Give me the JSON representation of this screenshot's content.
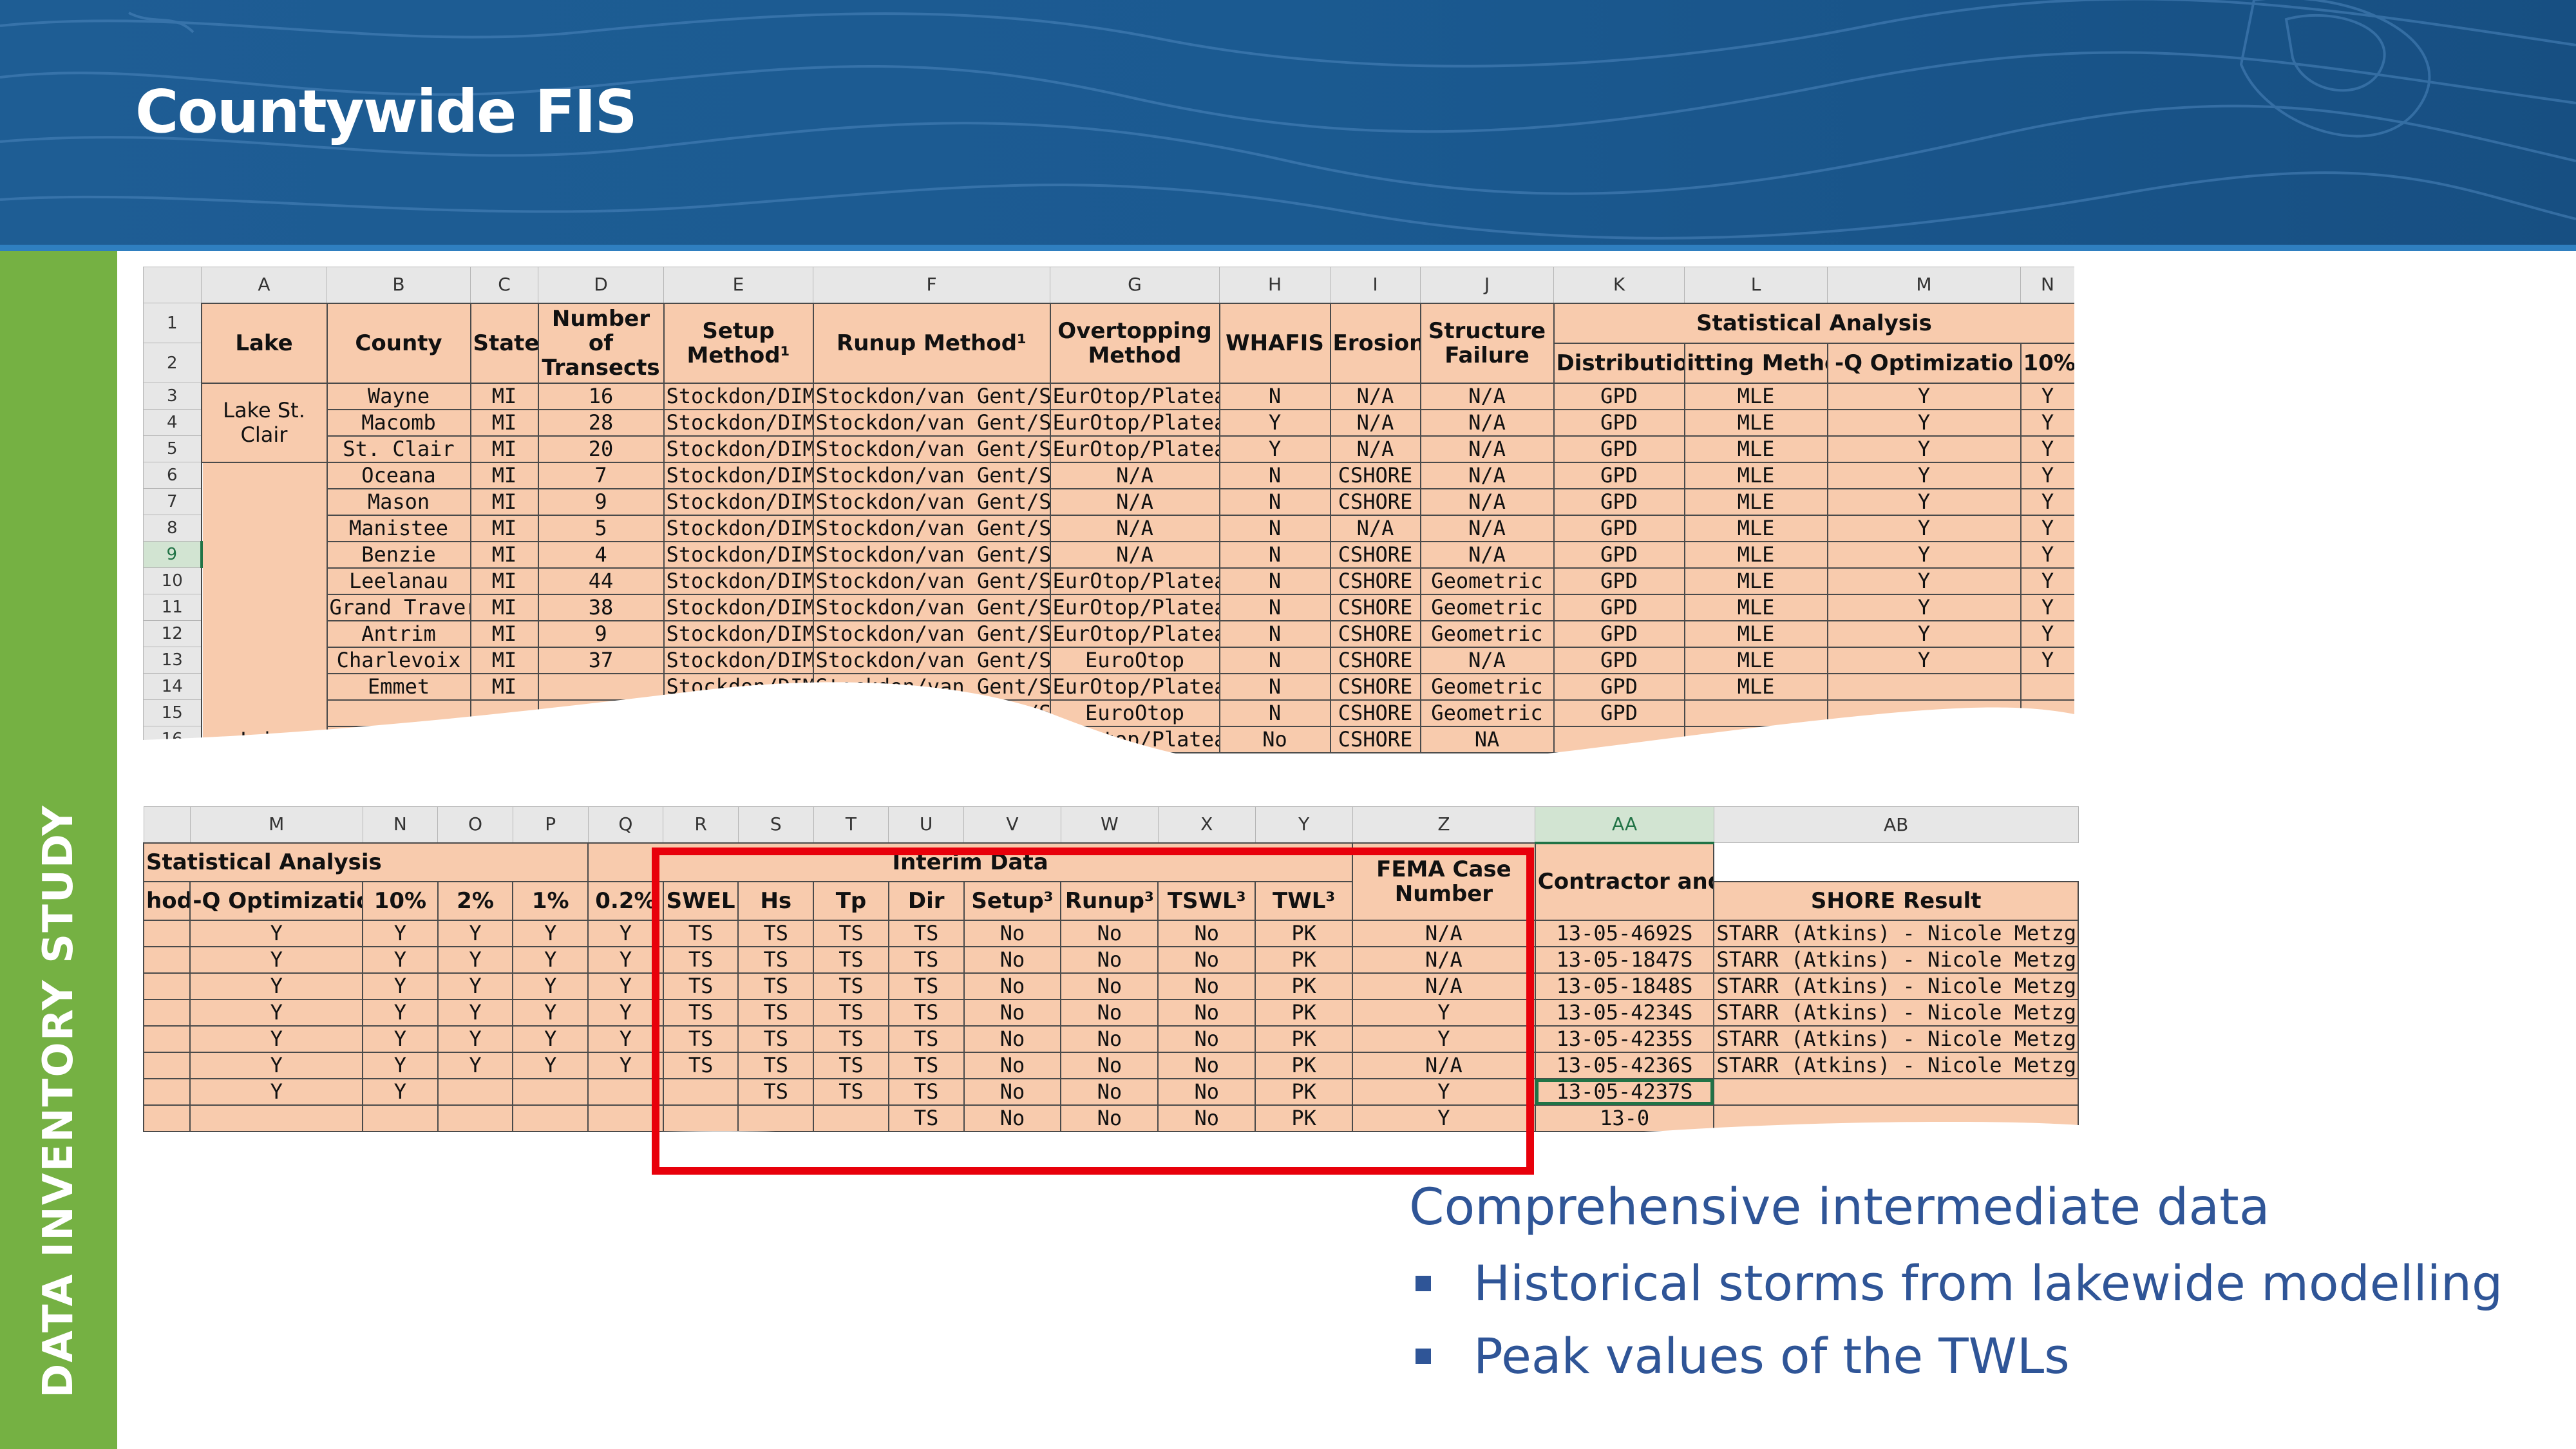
{
  "header": {
    "title": "Countywide FIS"
  },
  "sidebar": {
    "label": "DATA INVENTORY STUDY"
  },
  "colors": {
    "banner": "#1b5a91",
    "sidebar": "#75b143",
    "cell": "#f8cbad",
    "highlight": "#e8000b",
    "bullet_text": "#2f5597"
  },
  "top_sheet": {
    "col_letters": [
      "A",
      "B",
      "C",
      "D",
      "E",
      "F",
      "G",
      "H",
      "I",
      "J",
      "K",
      "L",
      "M",
      "N"
    ],
    "row_numbers": [
      "1",
      "2",
      "3",
      "4",
      "5",
      "6",
      "7",
      "8",
      "9",
      "10",
      "11",
      "12",
      "13",
      "14",
      "15",
      "16"
    ],
    "headers": {
      "lake": "Lake",
      "county": "County",
      "state": "State",
      "transects": "Number of Transects",
      "setup": "Setup Method¹",
      "runup": "Runup Method¹",
      "overtopping": "Overtopping Method",
      "whafis": "WHAFIS",
      "erosion": "Erosion",
      "structure": "Structure Failure",
      "stat_analysis": "Statistical Analysis",
      "distribution": "Distribution",
      "fitting": "itting Method",
      "optimization": "-Q Optimizatio",
      "pct10": "10%"
    },
    "lake_groups": [
      "Lake St. Clair",
      "Lake"
    ],
    "rows": [
      [
        "Wayne",
        "MI",
        "16",
        "Stockdon/DIM",
        "Stockdon/van Gent/SPM",
        "EurOtop/Plateau",
        "N",
        "N/A",
        "N/A",
        "GPD",
        "MLE",
        "Y",
        "Y"
      ],
      [
        "Macomb",
        "MI",
        "28",
        "Stockdon/DIM",
        "Stockdon/van Gent/SPM",
        "EurOtop/Plateau",
        "Y",
        "N/A",
        "N/A",
        "GPD",
        "MLE",
        "Y",
        "Y"
      ],
      [
        "St. Clair",
        "MI",
        "20",
        "Stockdon/DIM",
        "Stockdon/van Gent/SPM",
        "EurOtop/Plateau",
        "Y",
        "N/A",
        "N/A",
        "GPD",
        "MLE",
        "Y",
        "Y"
      ],
      [
        "Oceana",
        "MI",
        "7",
        "Stockdon/DIM",
        "Stockdon/van Gent/SPM",
        "N/A",
        "N",
        "CSHORE",
        "N/A",
        "GPD",
        "MLE",
        "Y",
        "Y"
      ],
      [
        "Mason",
        "MI",
        "9",
        "Stockdon/DIM",
        "Stockdon/van Gent/SPM",
        "N/A",
        "N",
        "CSHORE",
        "N/A",
        "GPD",
        "MLE",
        "Y",
        "Y"
      ],
      [
        "Manistee",
        "MI",
        "5",
        "Stockdon/DIM",
        "Stockdon/van Gent/SPM",
        "N/A",
        "N",
        "N/A",
        "N/A",
        "GPD",
        "MLE",
        "Y",
        "Y"
      ],
      [
        "Benzie",
        "MI",
        "4",
        "Stockdon/DIM",
        "Stockdon/van Gent/SPM",
        "N/A",
        "N",
        "CSHORE",
        "N/A",
        "GPD",
        "MLE",
        "Y",
        "Y"
      ],
      [
        "Leelanau",
        "MI",
        "44",
        "Stockdon/DIM",
        "Stockdon/van Gent/SPM",
        "EurOtop/Plateau",
        "N",
        "CSHORE",
        "Geometric",
        "GPD",
        "MLE",
        "Y",
        "Y"
      ],
      [
        "Grand Traverse",
        "MI",
        "38",
        "Stockdon/DIM",
        "Stockdon/van Gent/SPM",
        "EurOtop/Plateau",
        "N",
        "CSHORE",
        "Geometric",
        "GPD",
        "MLE",
        "Y",
        "Y"
      ],
      [
        "Antrim",
        "MI",
        "9",
        "Stockdon/DIM",
        "Stockdon/van Gent/SPM",
        "EurOtop/Plateau",
        "N",
        "CSHORE",
        "Geometric",
        "GPD",
        "MLE",
        "Y",
        "Y"
      ],
      [
        "Charlevoix",
        "MI",
        "37",
        "Stockdon/DIM",
        "Stockdon/van Gent/SPM",
        "EuroOtop",
        "N",
        "CSHORE",
        "N/A",
        "GPD",
        "MLE",
        "Y",
        "Y"
      ],
      [
        "Emmet",
        "MI",
        "",
        "Stockdon/DIM",
        "Stockdon/van Gent/SPM",
        "EurOtop/Plateau",
        "N",
        "CSHORE",
        "Geometric",
        "GPD",
        "MLE",
        "",
        ""
      ],
      [
        "",
        "",
        "",
        "",
        "Stockdon/van Gent/SPM",
        "EuroOtop",
        "N",
        "CSHORE",
        "Geometric",
        "GPD",
        "",
        "",
        ""
      ],
      [
        "",
        "",
        "",
        "",
        "van Gent/SPM",
        "EurOtop/Plateau",
        "No",
        "CSHORE",
        "NA",
        "",
        "",
        "",
        ""
      ]
    ]
  },
  "bottom_sheet": {
    "col_letters": [
      "M",
      "N",
      "O",
      "P",
      "Q",
      "R",
      "S",
      "T",
      "U",
      "V",
      "W",
      "X",
      "Y",
      "Z",
      "AA",
      "AB"
    ],
    "headers": {
      "stat_analysis": "Statistical Analysis",
      "interim": "Interim Data",
      "fema_case": "FEMA Case Number",
      "contractor": "Contractor and Contact",
      "fitting": "hod",
      "optimization": "-Q Optimizatio",
      "pct10": "10%",
      "pct2": "2%",
      "pct1": "1%",
      "pct02": "0.2%",
      "swel": "SWEL",
      "hs": "Hs",
      "tp": "Tp",
      "dir": "Dir",
      "setup": "Setup³",
      "runup": "Runup³",
      "tswl": "TSWL³",
      "twl": "TWL³",
      "cshore": "SHORE Result"
    },
    "rows": [
      [
        "Y",
        "Y",
        "Y",
        "Y",
        "Y",
        "TS",
        "TS",
        "TS",
        "TS",
        "No",
        "No",
        "No",
        "PK",
        "N/A",
        "13-05-4692S",
        "STARR (Atkins) - Nicole Metzger"
      ],
      [
        "Y",
        "Y",
        "Y",
        "Y",
        "Y",
        "TS",
        "TS",
        "TS",
        "TS",
        "No",
        "No",
        "No",
        "PK",
        "N/A",
        "13-05-1847S",
        "STARR (Atkins) - Nicole Metzger"
      ],
      [
        "Y",
        "Y",
        "Y",
        "Y",
        "Y",
        "TS",
        "TS",
        "TS",
        "TS",
        "No",
        "No",
        "No",
        "PK",
        "N/A",
        "13-05-1848S",
        "STARR (Atkins) - Nicole Metzger"
      ],
      [
        "Y",
        "Y",
        "Y",
        "Y",
        "Y",
        "TS",
        "TS",
        "TS",
        "TS",
        "No",
        "No",
        "No",
        "PK",
        "Y",
        "13-05-4234S",
        "STARR (Atkins) - Nicole Metzger"
      ],
      [
        "Y",
        "Y",
        "Y",
        "Y",
        "Y",
        "TS",
        "TS",
        "TS",
        "TS",
        "No",
        "No",
        "No",
        "PK",
        "Y",
        "13-05-4235S",
        "STARR (Atkins) - Nicole Metzger"
      ],
      [
        "Y",
        "Y",
        "Y",
        "Y",
        "Y",
        "TS",
        "TS",
        "TS",
        "TS",
        "No",
        "No",
        "No",
        "PK",
        "N/A",
        "13-05-4236S",
        "STARR (Atkins) - Nicole Metzger"
      ],
      [
        "Y",
        "Y",
        "",
        "",
        "",
        "",
        "TS",
        "TS",
        "TS",
        "No",
        "No",
        "No",
        "PK",
        "Y",
        "13-05-4237S",
        ""
      ],
      [
        "",
        "",
        "",
        "",
        "",
        "",
        "",
        "",
        "TS",
        "No",
        "No",
        "No",
        "PK",
        "Y",
        "13-0",
        ""
      ]
    ]
  },
  "bullets": {
    "heading": "Comprehensive intermediate data",
    "items": [
      "Historical storms from lakewide modelling",
      "Peak values of the TWLs"
    ]
  }
}
